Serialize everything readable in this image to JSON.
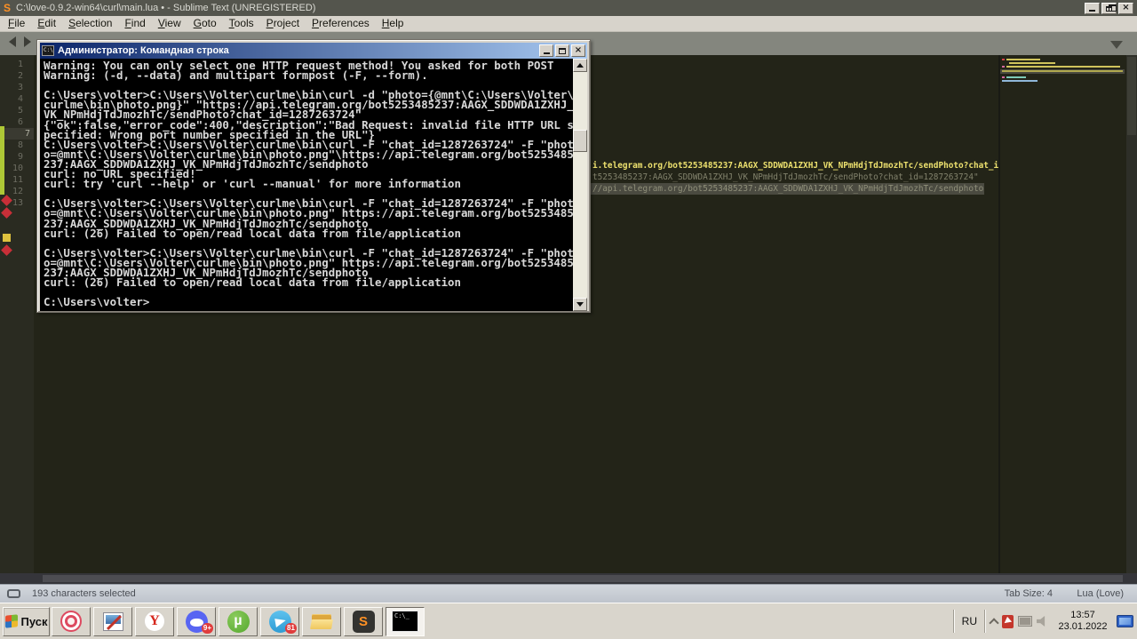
{
  "colors": {
    "editor_bg": "#232418",
    "gutter_bg": "#2a2b21",
    "selection": "#4a4a40",
    "string_yellow": "#ece06e",
    "modified_green": "#aec836",
    "marker_red": "#c82f38",
    "marker_yellow": "#dfc23e",
    "cmd_title_start": "#0b2569",
    "cmd_title_end": "#a7c8f0",
    "chrome": "#d7d3cb",
    "taskbar": "#d9d5cc",
    "status_start": "#d3d7dd",
    "status_end": "#bfc4cc",
    "sublime_orange": "#ff9124",
    "opera_red": "#dd4a60",
    "yandex_red": "#d6281e",
    "discord_blurple": "#5865f2",
    "utorrent_green": "#55a82e",
    "telegram_blue": "#2f9cd4",
    "badge_red": "#e03c3c"
  },
  "icons": {
    "sublime_logo_letter": "S",
    "cmd_icon_text": "C:\\"
  },
  "sublime": {
    "title": "C:\\love-0.9.2-win64\\curl\\main.lua • - Sublime Text (UNREGISTERED)",
    "menu": [
      "File",
      "Edit",
      "Selection",
      "Find",
      "View",
      "Goto",
      "Tools",
      "Project",
      "Preferences",
      "Help"
    ],
    "gutter_lines": [
      "1",
      "2",
      "3",
      "4",
      "5",
      "6",
      "7",
      "8",
      "9",
      "10",
      "11",
      "12",
      "13"
    ],
    "editor_fragments": [
      "i.telegram.org/bot5253485237:AAGX_SDDWDA1ZXHJ_VK_NPmHdjTdJmozhTc/sendPhoto?chat_i",
      "t5253485237:AAGX_SDDWDA1ZXHJ_VK_NPmHdjTdJmozhTc/sendPhoto?chat_id=1287263724\"",
      "//api.telegram.org/bot5253485237:AAGX_SDDWDA1ZXHJ_VK_NPmHdjTdJmozhTc/sendphoto"
    ],
    "status": {
      "selection": "193 characters selected",
      "tab_size": "Tab Size: 4",
      "syntax": "Lua (Love)"
    }
  },
  "cmd": {
    "title": "Администратор: Командная строка",
    "lines": [
      "Warning: You can only select one HTTP request method! You asked for both POST",
      "Warning: (-d, --data) and multipart formpost (-F, --form).",
      "",
      "C:\\Users\\volter>C:\\Users\\Volter\\curlme\\bin\\curl -d \"photo={@mnt\\C:\\Users\\Volter\\",
      "curlme\\bin\\photo.png}\" \"https://api.telegram.org/bot5253485237:AAGX_SDDWDA1ZXHJ_",
      "VK_NPmHdjTdJmozhTc/sendPhoto?chat_id=1287263724\"",
      "{\"ok\":false,\"error_code\":400,\"description\":\"Bad Request: invalid file HTTP URL s",
      "pecified: Wrong port number specified in the URL\"}",
      "C:\\Users\\volter>C:\\Users\\Volter\\curlme\\bin\\curl -F \"chat_id=1287263724\" -F \"phot",
      "o=@mnt\\C:\\Users\\Volter\\curlme\\bin\\photo.png\"\\https://api.telegram.org/bot5253485",
      "237:AAGX_SDDWDA1ZXHJ_VK_NPmHdjTdJmozhTc/sendphoto",
      "curl: no URL specified!",
      "curl: try 'curl --help' or 'curl --manual' for more information",
      "",
      "C:\\Users\\volter>C:\\Users\\Volter\\curlme\\bin\\curl -F \"chat_id=1287263724\" -F \"phot",
      "o=@mnt\\C:\\Users\\Volter\\curlme\\bin\\photo.png\" https://api.telegram.org/bot5253485",
      "237:AAGX_SDDWDA1ZXHJ_VK_NPmHdjTdJmozhTc/sendphoto",
      "curl: (26) Failed to open/read local data from file/application",
      "",
      "C:\\Users\\volter>C:\\Users\\Volter\\curlme\\bin\\curl -F \"chat_id=1287263724\" -F \"phot",
      "o=@mnt\\C:\\Users\\Volter\\curlme\\bin\\photo.png\" https://api.telegram.org/bot5253485",
      "237:AAGX_SDDWDA1ZXHJ_VK_NPmHdjTdJmozhTc/sendphoto",
      "curl: (26) Failed to open/read local data from file/application",
      "",
      "C:\\Users\\volter>"
    ]
  },
  "taskbar": {
    "start_label": "Пуск",
    "apps": [
      {
        "name": "opera-gx",
        "icon": "opera"
      },
      {
        "name": "paint",
        "icon": "paint"
      },
      {
        "name": "yandex-browser",
        "icon": "yandex",
        "glyph": "Y"
      },
      {
        "name": "discord",
        "icon": "discord",
        "badge": "9+"
      },
      {
        "name": "utorrent",
        "icon": "utorrent",
        "glyph": "µ"
      },
      {
        "name": "telegram",
        "icon": "telegram",
        "badge": "81"
      },
      {
        "name": "file-explorer",
        "icon": "explorer"
      },
      {
        "name": "sublime-text",
        "icon": "sublime",
        "glyph": "S"
      },
      {
        "name": "command-prompt",
        "icon": "cmd",
        "glyph": "C:\\_",
        "active": "true"
      }
    ],
    "tray": {
      "lang": "RU",
      "time": "13:57",
      "date": "23.01.2022"
    }
  }
}
